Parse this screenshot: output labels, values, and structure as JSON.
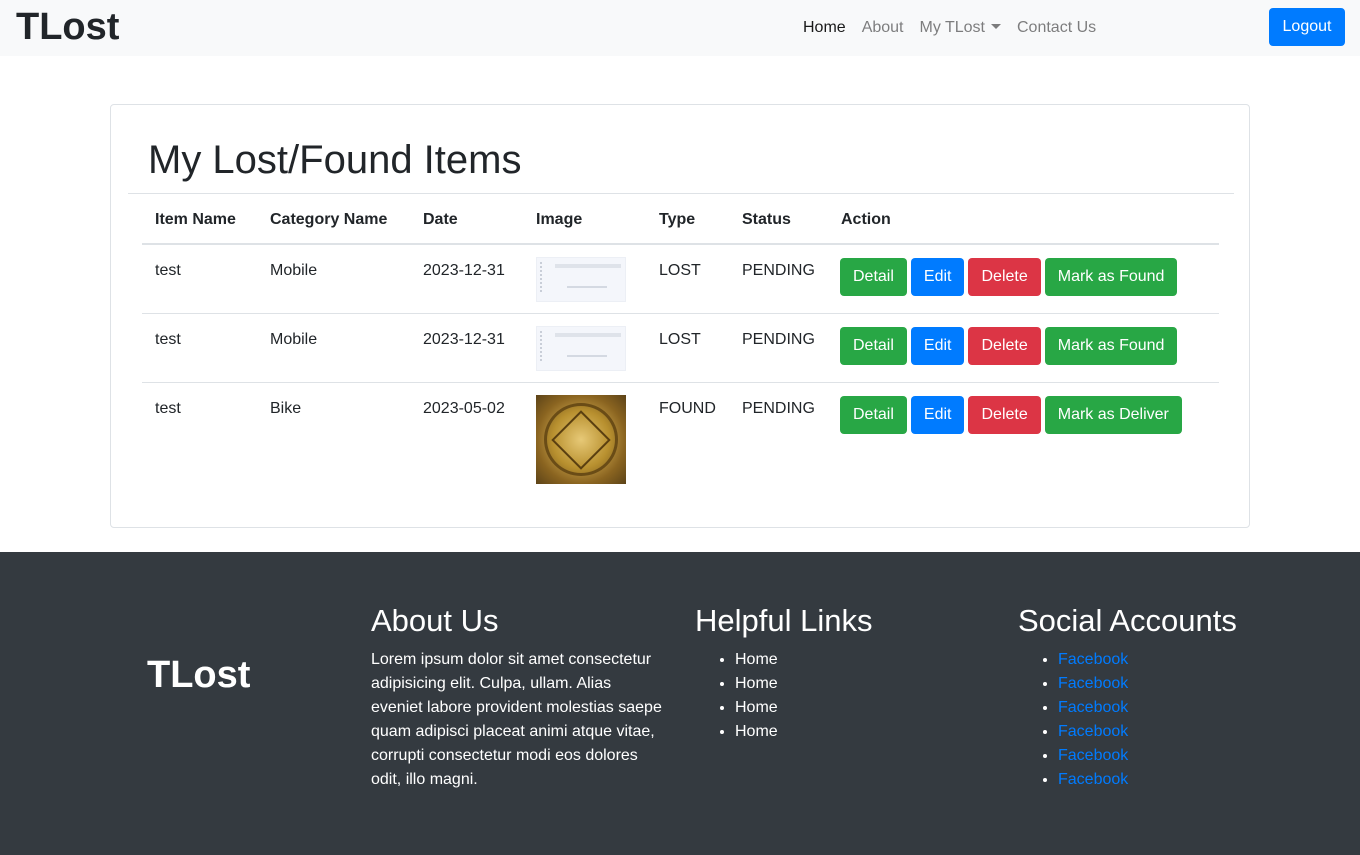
{
  "navbar": {
    "brand": "TLost",
    "links": [
      {
        "label": "Home"
      },
      {
        "label": "About"
      },
      {
        "label": "My TLost"
      },
      {
        "label": "Contact Us"
      }
    ],
    "logout_label": "Logout"
  },
  "card": {
    "title": "My Lost/Found Items",
    "columns": [
      "Item Name",
      "Category Name",
      "Date",
      "Image",
      "Type",
      "Status",
      "Action"
    ],
    "rows": [
      {
        "name": "test",
        "category": "Mobile",
        "date": "2023-12-31",
        "image": "screenshot-thumbnail",
        "type": "LOST",
        "status": "PENDING",
        "actions": {
          "detail": "Detail",
          "edit": "Edit",
          "delete": "Delete",
          "mark": "Mark as Found"
        }
      },
      {
        "name": "test",
        "category": "Mobile",
        "date": "2023-12-31",
        "image": "screenshot-thumbnail",
        "type": "LOST",
        "status": "PENDING",
        "actions": {
          "detail": "Detail",
          "edit": "Edit",
          "delete": "Delete",
          "mark": "Mark as Found"
        }
      },
      {
        "name": "test",
        "category": "Bike",
        "date": "2023-05-02",
        "image": "gold-seal-image",
        "type": "FOUND",
        "status": "PENDING",
        "actions": {
          "detail": "Detail",
          "edit": "Edit",
          "delete": "Delete",
          "mark": "Mark as Deliver"
        }
      }
    ]
  },
  "footer": {
    "brand": "TLost",
    "about": {
      "heading": "About Us",
      "text": "Lorem ipsum dolor sit amet consectetur adipisicing elit. Culpa, ullam. Alias eveniet labore provident molestias saepe quam adipisci placeat animi atque vitae, corrupti consectetur modi eos dolores odit, illo magni."
    },
    "helpful": {
      "heading": "Helpful Links",
      "links": [
        "Home",
        "Home",
        "Home",
        "Home"
      ]
    },
    "social": {
      "heading": "Social Accounts",
      "links": [
        "Facebook",
        "Facebook",
        "Facebook",
        "Facebook",
        "Facebook",
        "Facebook"
      ]
    }
  },
  "colors": {
    "primary": "#007bff",
    "success": "#28a745",
    "danger": "#dc3545",
    "footer_bg": "#343a40",
    "navbar_bg": "#f8f9fa"
  }
}
